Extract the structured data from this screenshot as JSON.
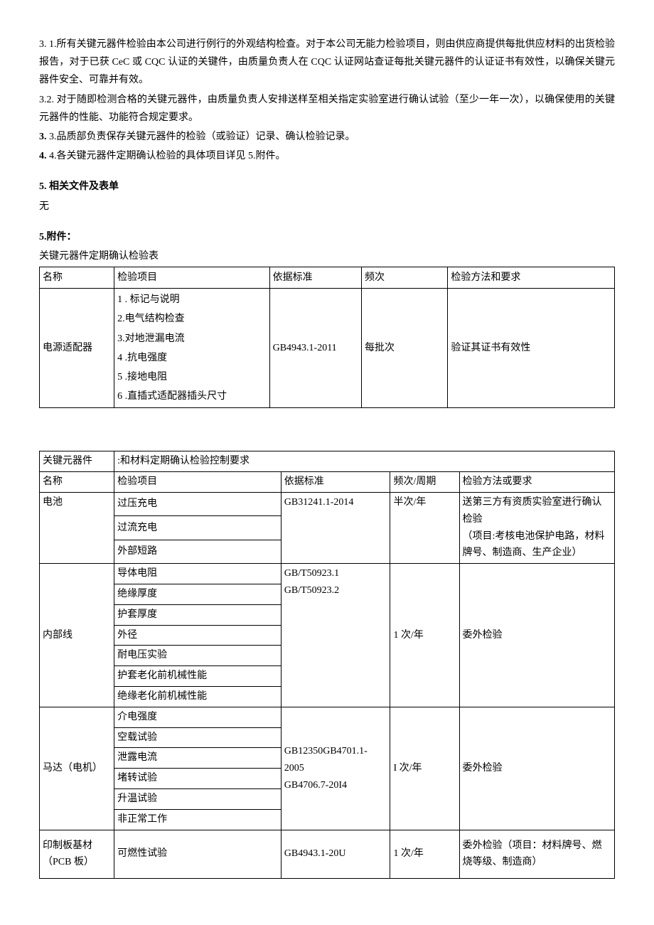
{
  "paras": {
    "p31": "3.  1.所有关键元器件检验由本公司进行例行的外观结构检查。对于本公司无能力检验项目，则由供应商提供每批供应材料的出货检验报告，对于已获 CeC 或 CQC 认证的关键件，由质量负责人在 CQC 认证网站查证每批关键元器件的认证证书有效性，以确保关键元器件安全、可靠并有效。",
    "p32": "3.2.   对于随即检测合格的关键元器件，由质量负责人安排送样至相关指定实验室进行确认试验（至少一年一次），以确保使用的关键元器件的性能、功能符合规定要求。",
    "p33_prefix": "3.",
    "p33": "  3.品质部负责保存关键元器件的检验（或验证）记录、确认检验记录。",
    "p34_prefix": "4.",
    "p34": "  4.各关键元器件定期确认检验的具体项目详见 5.附件。",
    "p5_prefix": "5.",
    "p5": "   相关文件及表单",
    "p5b": "无",
    "p5att": "5.附件：",
    "caption1": "关键元器件定期确认检验表"
  },
  "table1": {
    "headers": [
      "名称",
      "检验项目",
      "依据标准",
      "频次",
      "检验方法和要求"
    ],
    "row": {
      "name": "电源适配器",
      "items": [
        "1          . 标记与说明",
        "2.电气结构检查",
        "3.对地泄漏电流",
        "4 .抗电强度",
        "5 .接地电阻",
        "6 .直插式适配器插头尺寸"
      ],
      "std": "GB4943.1-2011",
      "freq": "每批次",
      "method": "验证其证书有效性"
    }
  },
  "table2": {
    "title_left": "关键元器件",
    "title_right": ":和材料定期确认检验控制要求",
    "headers": [
      "名称",
      "检验项目",
      "依据标准",
      "频次/周期",
      "检验方法或要求"
    ],
    "rows": {
      "battery": {
        "name": "电池",
        "items": [
          "过压充电",
          "过流充电",
          "外部短路"
        ],
        "std": "GB31241.1-2014",
        "freq": "半次/年",
        "method": "送第三方有资质实验室进行确认检验\n（项目:考核电池保护电路，材料牌号、制造商、生产企业）"
      },
      "wire": {
        "name": "内部线",
        "items": [
          "导体电阻",
          "绝缘厚度",
          "护套厚度",
          "外径",
          "耐电压实验",
          "护套老化前机械性能",
          "绝缘老化前机械性能"
        ],
        "std": "GB/T50923.1\nGB/T50923.2",
        "freq": "1 次/年",
        "method": "委外检验"
      },
      "motor": {
        "name": "马达（电机）",
        "items": [
          "介电强度",
          "空载试验",
          "泄露电流",
          "堵转试验",
          "升温试验",
          "非正常工作"
        ],
        "std": "GB12350GB4701.1-2005\nGB4706.7-20I4",
        "freq": "I 次/年",
        "method": "委外检验"
      },
      "pcb": {
        "name": "印制板基材（PCB 板）",
        "items": [
          "可燃性试验"
        ],
        "std": "GB4943.1-20U",
        "freq": "1 次/年",
        "method": "委外检验（项目：材料牌号、燃烧等级、制造商）"
      }
    }
  }
}
